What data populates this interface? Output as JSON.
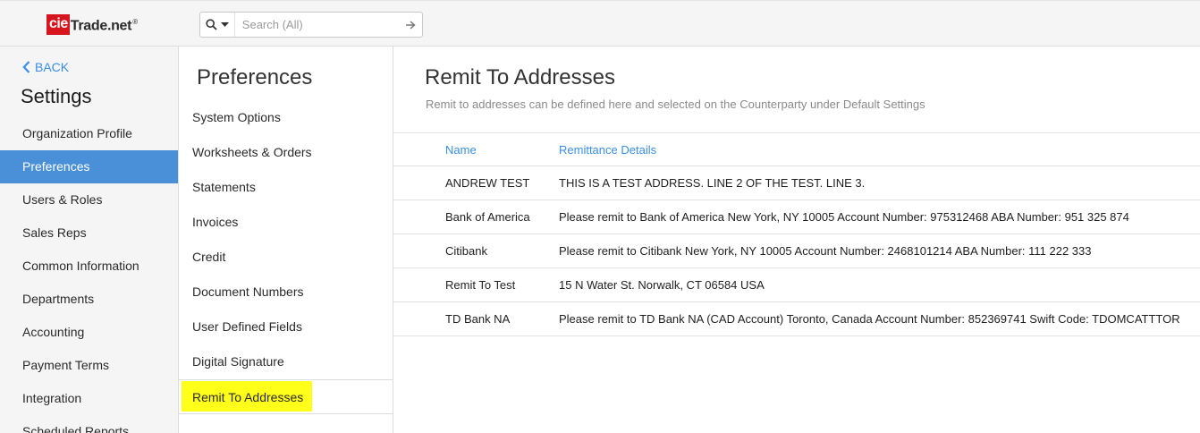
{
  "logo": {
    "part1": "cie",
    "part2": "Trade.net",
    "reg": "®"
  },
  "search": {
    "placeholder": "Search (All)",
    "scope_icon": "search-icon"
  },
  "leftnav": {
    "back_label": "BACK",
    "title": "Settings",
    "items": [
      {
        "label": "Organization Profile",
        "active": false
      },
      {
        "label": "Preferences",
        "active": true
      },
      {
        "label": "Users & Roles",
        "active": false
      },
      {
        "label": "Sales Reps",
        "active": false
      },
      {
        "label": "Common Information",
        "active": false
      },
      {
        "label": "Departments",
        "active": false
      },
      {
        "label": "Accounting",
        "active": false
      },
      {
        "label": "Payment Terms",
        "active": false
      },
      {
        "label": "Integration",
        "active": false
      },
      {
        "label": "Scheduled Reports",
        "active": false
      }
    ]
  },
  "midpanel": {
    "title": "Preferences",
    "items": [
      {
        "label": "System Options",
        "active": false
      },
      {
        "label": "Worksheets & Orders",
        "active": false
      },
      {
        "label": "Statements",
        "active": false
      },
      {
        "label": "Invoices",
        "active": false
      },
      {
        "label": "Credit",
        "active": false
      },
      {
        "label": "Document Numbers",
        "active": false
      },
      {
        "label": "User Defined Fields",
        "active": false
      },
      {
        "label": "Digital Signature",
        "active": false
      },
      {
        "label": "Remit To Addresses",
        "active": true
      }
    ]
  },
  "main": {
    "title": "Remit To Addresses",
    "subtitle": "Remit to addresses can be defined here and selected on the Counterparty under Default Settings",
    "columns": [
      "Name",
      "Remittance Details"
    ],
    "rows": [
      {
        "name": "ANDREW TEST",
        "details": "THIS IS A TEST ADDRESS. LINE 2 OF THE TEST. LINE 3."
      },
      {
        "name": "Bank of America",
        "details": "Please remit to Bank of America New York, NY 10005 Account Number: 975312468 ABA Number: 951 325 874"
      },
      {
        "name": "Citibank",
        "details": "Please remit to Citibank New York, NY 10005 Account Number: 2468101214 ABA Number: 111 222 333"
      },
      {
        "name": "Remit To Test",
        "details": "15 N Water St. Norwalk, CT 06584 USA"
      },
      {
        "name": "TD Bank NA",
        "details": "Please remit to TD Bank NA (CAD Account) Toronto, Canada Account Number: 852369741 Swift Code: TDOMCATTTOR"
      }
    ]
  },
  "colors": {
    "accent": "#4a90d9",
    "link": "#3a8ee6",
    "highlight": "#ffff1a",
    "brand_red": "#d7151f"
  }
}
